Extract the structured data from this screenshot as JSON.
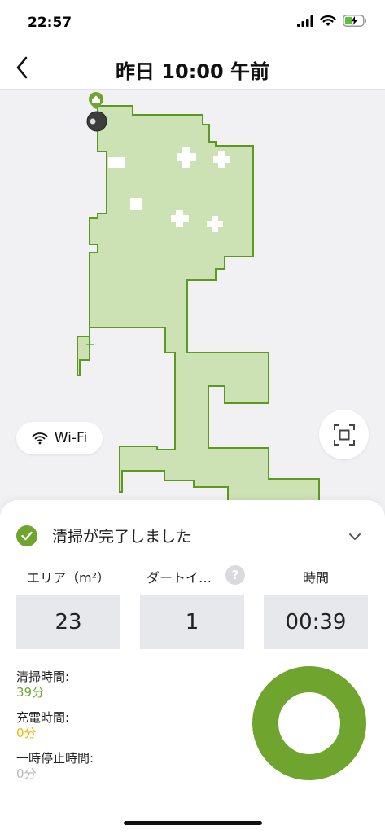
{
  "status_bar": {
    "time": "22:57"
  },
  "header": {
    "title": "昨日 10:00 午前"
  },
  "map": {
    "wifi_label": "Wi-Fi",
    "fill_color": "#cde2b4",
    "edge_color": "#5c9a1f"
  },
  "summary": {
    "status_text": "清掃が完了しました",
    "stats": [
      {
        "label": "エリア（m²）",
        "value": "23"
      },
      {
        "label": "ダートイ…",
        "value": "1"
      },
      {
        "label": "時間",
        "value": "00:39"
      }
    ],
    "help_glyph": "?",
    "breakdown": [
      {
        "label": "清掃時間:",
        "value": "39分",
        "color": "#6fa52f"
      },
      {
        "label": "充電時間:",
        "value": "0分",
        "color": "#f0b400"
      },
      {
        "label": "一時停止時間:",
        "value": "0分",
        "color": "#b8b8b8"
      }
    ],
    "donut": {
      "cleaning_fraction": 1.0,
      "color": "#6fa52f"
    }
  },
  "colors": {
    "accent": "#6fa52f"
  }
}
